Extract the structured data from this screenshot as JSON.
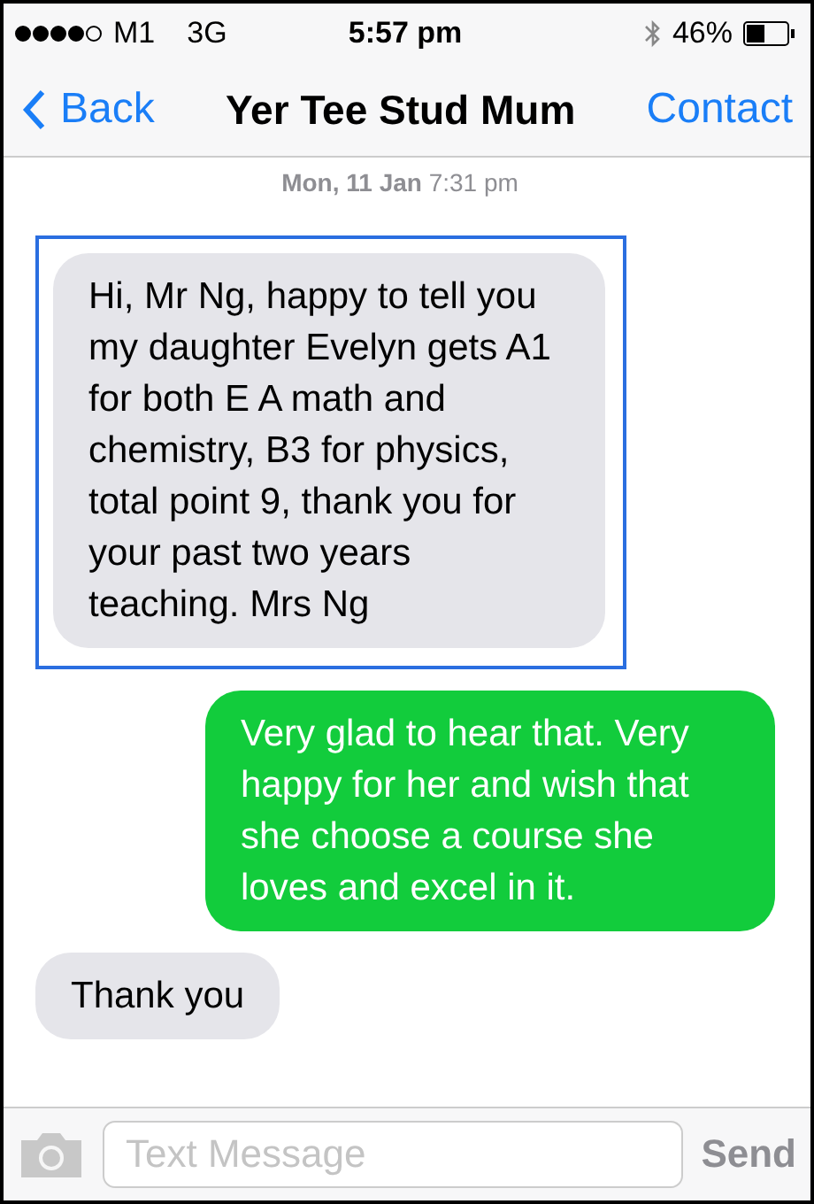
{
  "status_bar": {
    "signal_dots": [
      {
        "on": true
      },
      {
        "on": true
      },
      {
        "on": true
      },
      {
        "on": true
      },
      {
        "on": false
      }
    ],
    "carrier": "M1",
    "network": "3G",
    "time": "5:57 pm",
    "battery": "46%"
  },
  "nav": {
    "back": "Back",
    "title": "Yer Tee Stud Mum",
    "action": "Contact"
  },
  "timestamp": {
    "day": "Mon, 11 Jan",
    "time": "7:31 pm"
  },
  "messages": [
    {
      "kind": "received",
      "text": "Hi, Mr Ng,  happy to tell you my daughter Evelyn gets A1 for both E A math and chemistry, B3 for physics, total point 9, thank you for your past two years teaching. Mrs Ng",
      "selected": true
    },
    {
      "kind": "sent",
      "text": "Very glad to hear that. Very happy for her and wish that she choose a course she loves and excel in it.",
      "selected": false
    },
    {
      "kind": "received",
      "text": "Thank you",
      "selected": false
    }
  ],
  "input": {
    "placeholder": "Text Message",
    "send": "Send"
  }
}
